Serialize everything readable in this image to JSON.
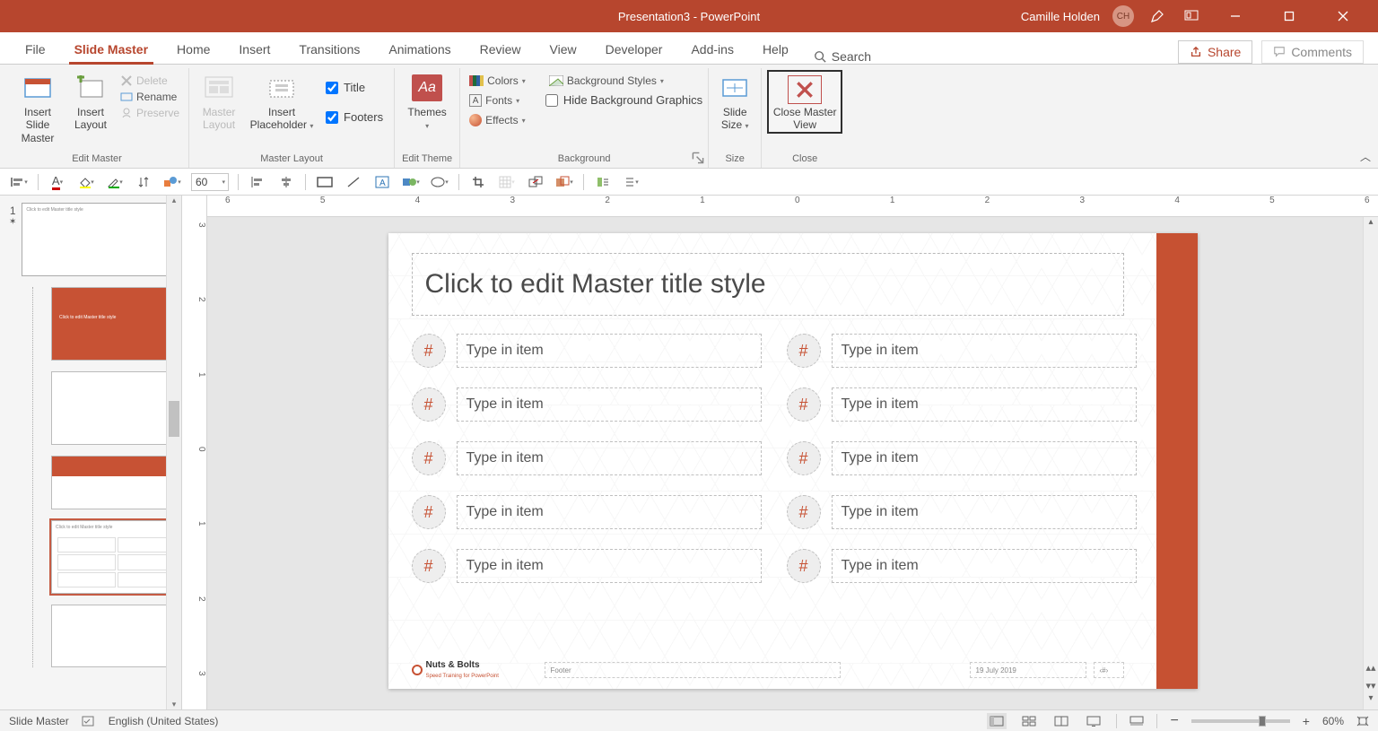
{
  "window": {
    "title": "Presentation3  -  PowerPoint",
    "user": "Camille Holden",
    "user_initials": "CH"
  },
  "tabs": {
    "items": [
      "File",
      "Slide Master",
      "Home",
      "Insert",
      "Transitions",
      "Animations",
      "Review",
      "View",
      "Developer",
      "Add-ins",
      "Help"
    ],
    "active_index": 1,
    "search": "Search",
    "share": "Share",
    "comments": "Comments"
  },
  "ribbon": {
    "groups": {
      "edit_master": {
        "label": "Edit Master",
        "insert_slide_master": "Insert Slide Master",
        "insert_layout": "Insert Layout",
        "delete": "Delete",
        "rename": "Rename",
        "preserve": "Preserve"
      },
      "master_layout": {
        "label": "Master Layout",
        "master_layout_btn": "Master Layout",
        "insert_placeholder": "Insert Placeholder",
        "chk_title": "Title",
        "chk_footers": "Footers"
      },
      "edit_theme": {
        "label": "Edit Theme",
        "themes": "Themes"
      },
      "background": {
        "label": "Background",
        "colors": "Colors",
        "fonts": "Fonts",
        "effects": "Effects",
        "bg_styles": "Background Styles",
        "hide_bg": "Hide Background Graphics"
      },
      "size": {
        "label": "Size",
        "slide_size": "Slide Size"
      },
      "close": {
        "label": "Close",
        "close_master": "Close Master View"
      }
    }
  },
  "qat": {
    "font_size": "60"
  },
  "ruler": {
    "h": [
      "6",
      "5",
      "4",
      "3",
      "2",
      "1",
      "0",
      "1",
      "2",
      "3",
      "4",
      "5",
      "6"
    ],
    "v": [
      "3",
      "2",
      "1",
      "0",
      "1",
      "2",
      "3"
    ]
  },
  "slide": {
    "title": "Click to edit Master title style",
    "item_bubble": "#",
    "item_text": "Type in item",
    "footer_brand_a": "Nuts & Bolts",
    "footer_brand_b": "Speed Training for PowerPoint",
    "footer_label": "Footer",
    "footer_date": "19 July 2019",
    "footer_num": "‹#›"
  },
  "thumbnails": {
    "index": "1"
  },
  "statusbar": {
    "mode": "Slide Master",
    "lang": "English (United States)",
    "zoom": "60%"
  }
}
